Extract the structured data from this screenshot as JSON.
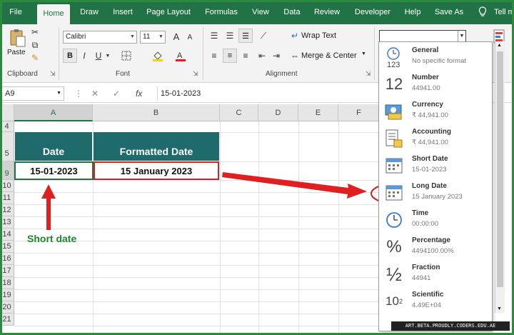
{
  "ribbon_tabs": [
    "File",
    "Home",
    "Draw",
    "Insert",
    "Page Layout",
    "Formulas",
    "View",
    "Data",
    "Review",
    "Developer",
    "Help",
    "Save As"
  ],
  "tell_me": "Tell m",
  "clipboard": {
    "paste_label": "Paste",
    "group_label": "Clipboard"
  },
  "font": {
    "name": "Calibri",
    "size": "11",
    "bold": "B",
    "italic": "I",
    "underline": "U",
    "increase": "A",
    "decrease": "A",
    "group_label": "Font"
  },
  "alignment": {
    "wrap_text": "Wrap Text",
    "merge_center": "Merge & Center",
    "group_label": "Alignment"
  },
  "formula_bar": {
    "name_box": "A9",
    "cancel": "✕",
    "enter": "✓",
    "fx": "fx",
    "value": "15-01-2023"
  },
  "columns": [
    "A",
    "B",
    "C",
    "D",
    "E",
    "F"
  ],
  "rows": [
    "4",
    "5",
    "9",
    "10",
    "11",
    "12",
    "13",
    "14",
    "15",
    "16",
    "17",
    "18",
    "19",
    "20",
    "21"
  ],
  "table": {
    "header_date": "Date",
    "header_formatted": "Formatted Date",
    "cell_date": "15-01-2023",
    "cell_formatted": "15 January 2023"
  },
  "annotation": {
    "short_date_label": "Short date",
    "arrow_color": "#e02020",
    "label_color": "#1e8a2e"
  },
  "number_formats": [
    {
      "name": "General",
      "sample": "No specific format",
      "icon": "clock-123-icon"
    },
    {
      "name": "Number",
      "sample": "44941.00",
      "icon": "number-12-icon",
      "glyph": "12"
    },
    {
      "name": "Currency",
      "sample": "₹ 44,941.00",
      "icon": "currency-icon"
    },
    {
      "name": "Accounting",
      "sample": "₹ 44,941.00",
      "icon": "accounting-icon"
    },
    {
      "name": "Short Date",
      "sample": "15-01-2023",
      "icon": "calendar-icon"
    },
    {
      "name": "Long Date",
      "sample": "15 January 2023",
      "icon": "calendar-icon"
    },
    {
      "name": "Time",
      "sample": "00:00:00",
      "icon": "clock-icon"
    },
    {
      "name": "Percentage",
      "sample": "4494100.00%",
      "icon": "percent-icon",
      "glyph": "%"
    },
    {
      "name": "Fraction",
      "sample": "44941",
      "icon": "fraction-icon",
      "glyph": "½"
    },
    {
      "name": "Scientific",
      "sample": "4.49E+04",
      "icon": "scientific-icon",
      "glyph": "10"
    }
  ],
  "watermark": "ART.BETA.PROUDLY.CODERS.EDU.AE",
  "colors": {
    "excel_green": "#217346",
    "teal_header": "#1f6b6b",
    "red_highlight": "#d32222"
  }
}
